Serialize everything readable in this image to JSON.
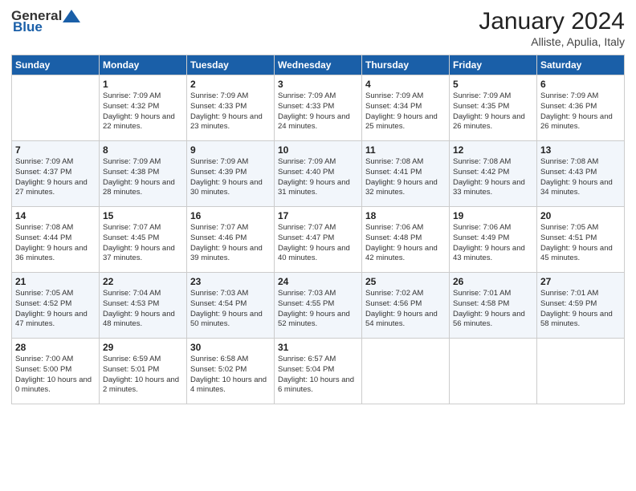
{
  "header": {
    "logo_general": "General",
    "logo_blue": "Blue",
    "month_title": "January 2024",
    "location": "Alliste, Apulia, Italy"
  },
  "days_of_week": [
    "Sunday",
    "Monday",
    "Tuesday",
    "Wednesday",
    "Thursday",
    "Friday",
    "Saturday"
  ],
  "weeks": [
    [
      {
        "date": "",
        "sunrise": "",
        "sunset": "",
        "daylight": "",
        "empty": true
      },
      {
        "date": "1",
        "sunrise": "Sunrise: 7:09 AM",
        "sunset": "Sunset: 4:32 PM",
        "daylight": "Daylight: 9 hours and 22 minutes."
      },
      {
        "date": "2",
        "sunrise": "Sunrise: 7:09 AM",
        "sunset": "Sunset: 4:33 PM",
        "daylight": "Daylight: 9 hours and 23 minutes."
      },
      {
        "date": "3",
        "sunrise": "Sunrise: 7:09 AM",
        "sunset": "Sunset: 4:33 PM",
        "daylight": "Daylight: 9 hours and 24 minutes."
      },
      {
        "date": "4",
        "sunrise": "Sunrise: 7:09 AM",
        "sunset": "Sunset: 4:34 PM",
        "daylight": "Daylight: 9 hours and 25 minutes."
      },
      {
        "date": "5",
        "sunrise": "Sunrise: 7:09 AM",
        "sunset": "Sunset: 4:35 PM",
        "daylight": "Daylight: 9 hours and 26 minutes."
      },
      {
        "date": "6",
        "sunrise": "Sunrise: 7:09 AM",
        "sunset": "Sunset: 4:36 PM",
        "daylight": "Daylight: 9 hours and 26 minutes."
      }
    ],
    [
      {
        "date": "7",
        "sunrise": "Sunrise: 7:09 AM",
        "sunset": "Sunset: 4:37 PM",
        "daylight": "Daylight: 9 hours and 27 minutes."
      },
      {
        "date": "8",
        "sunrise": "Sunrise: 7:09 AM",
        "sunset": "Sunset: 4:38 PM",
        "daylight": "Daylight: 9 hours and 28 minutes."
      },
      {
        "date": "9",
        "sunrise": "Sunrise: 7:09 AM",
        "sunset": "Sunset: 4:39 PM",
        "daylight": "Daylight: 9 hours and 30 minutes."
      },
      {
        "date": "10",
        "sunrise": "Sunrise: 7:09 AM",
        "sunset": "Sunset: 4:40 PM",
        "daylight": "Daylight: 9 hours and 31 minutes."
      },
      {
        "date": "11",
        "sunrise": "Sunrise: 7:08 AM",
        "sunset": "Sunset: 4:41 PM",
        "daylight": "Daylight: 9 hours and 32 minutes."
      },
      {
        "date": "12",
        "sunrise": "Sunrise: 7:08 AM",
        "sunset": "Sunset: 4:42 PM",
        "daylight": "Daylight: 9 hours and 33 minutes."
      },
      {
        "date": "13",
        "sunrise": "Sunrise: 7:08 AM",
        "sunset": "Sunset: 4:43 PM",
        "daylight": "Daylight: 9 hours and 34 minutes."
      }
    ],
    [
      {
        "date": "14",
        "sunrise": "Sunrise: 7:08 AM",
        "sunset": "Sunset: 4:44 PM",
        "daylight": "Daylight: 9 hours and 36 minutes."
      },
      {
        "date": "15",
        "sunrise": "Sunrise: 7:07 AM",
        "sunset": "Sunset: 4:45 PM",
        "daylight": "Daylight: 9 hours and 37 minutes."
      },
      {
        "date": "16",
        "sunrise": "Sunrise: 7:07 AM",
        "sunset": "Sunset: 4:46 PM",
        "daylight": "Daylight: 9 hours and 39 minutes."
      },
      {
        "date": "17",
        "sunrise": "Sunrise: 7:07 AM",
        "sunset": "Sunset: 4:47 PM",
        "daylight": "Daylight: 9 hours and 40 minutes."
      },
      {
        "date": "18",
        "sunrise": "Sunrise: 7:06 AM",
        "sunset": "Sunset: 4:48 PM",
        "daylight": "Daylight: 9 hours and 42 minutes."
      },
      {
        "date": "19",
        "sunrise": "Sunrise: 7:06 AM",
        "sunset": "Sunset: 4:49 PM",
        "daylight": "Daylight: 9 hours and 43 minutes."
      },
      {
        "date": "20",
        "sunrise": "Sunrise: 7:05 AM",
        "sunset": "Sunset: 4:51 PM",
        "daylight": "Daylight: 9 hours and 45 minutes."
      }
    ],
    [
      {
        "date": "21",
        "sunrise": "Sunrise: 7:05 AM",
        "sunset": "Sunset: 4:52 PM",
        "daylight": "Daylight: 9 hours and 47 minutes."
      },
      {
        "date": "22",
        "sunrise": "Sunrise: 7:04 AM",
        "sunset": "Sunset: 4:53 PM",
        "daylight": "Daylight: 9 hours and 48 minutes."
      },
      {
        "date": "23",
        "sunrise": "Sunrise: 7:03 AM",
        "sunset": "Sunset: 4:54 PM",
        "daylight": "Daylight: 9 hours and 50 minutes."
      },
      {
        "date": "24",
        "sunrise": "Sunrise: 7:03 AM",
        "sunset": "Sunset: 4:55 PM",
        "daylight": "Daylight: 9 hours and 52 minutes."
      },
      {
        "date": "25",
        "sunrise": "Sunrise: 7:02 AM",
        "sunset": "Sunset: 4:56 PM",
        "daylight": "Daylight: 9 hours and 54 minutes."
      },
      {
        "date": "26",
        "sunrise": "Sunrise: 7:01 AM",
        "sunset": "Sunset: 4:58 PM",
        "daylight": "Daylight: 9 hours and 56 minutes."
      },
      {
        "date": "27",
        "sunrise": "Sunrise: 7:01 AM",
        "sunset": "Sunset: 4:59 PM",
        "daylight": "Daylight: 9 hours and 58 minutes."
      }
    ],
    [
      {
        "date": "28",
        "sunrise": "Sunrise: 7:00 AM",
        "sunset": "Sunset: 5:00 PM",
        "daylight": "Daylight: 10 hours and 0 minutes."
      },
      {
        "date": "29",
        "sunrise": "Sunrise: 6:59 AM",
        "sunset": "Sunset: 5:01 PM",
        "daylight": "Daylight: 10 hours and 2 minutes."
      },
      {
        "date": "30",
        "sunrise": "Sunrise: 6:58 AM",
        "sunset": "Sunset: 5:02 PM",
        "daylight": "Daylight: 10 hours and 4 minutes."
      },
      {
        "date": "31",
        "sunrise": "Sunrise: 6:57 AM",
        "sunset": "Sunset: 5:04 PM",
        "daylight": "Daylight: 10 hours and 6 minutes."
      },
      {
        "date": "",
        "sunrise": "",
        "sunset": "",
        "daylight": "",
        "empty": true
      },
      {
        "date": "",
        "sunrise": "",
        "sunset": "",
        "daylight": "",
        "empty": true
      },
      {
        "date": "",
        "sunrise": "",
        "sunset": "",
        "daylight": "",
        "empty": true
      }
    ]
  ]
}
